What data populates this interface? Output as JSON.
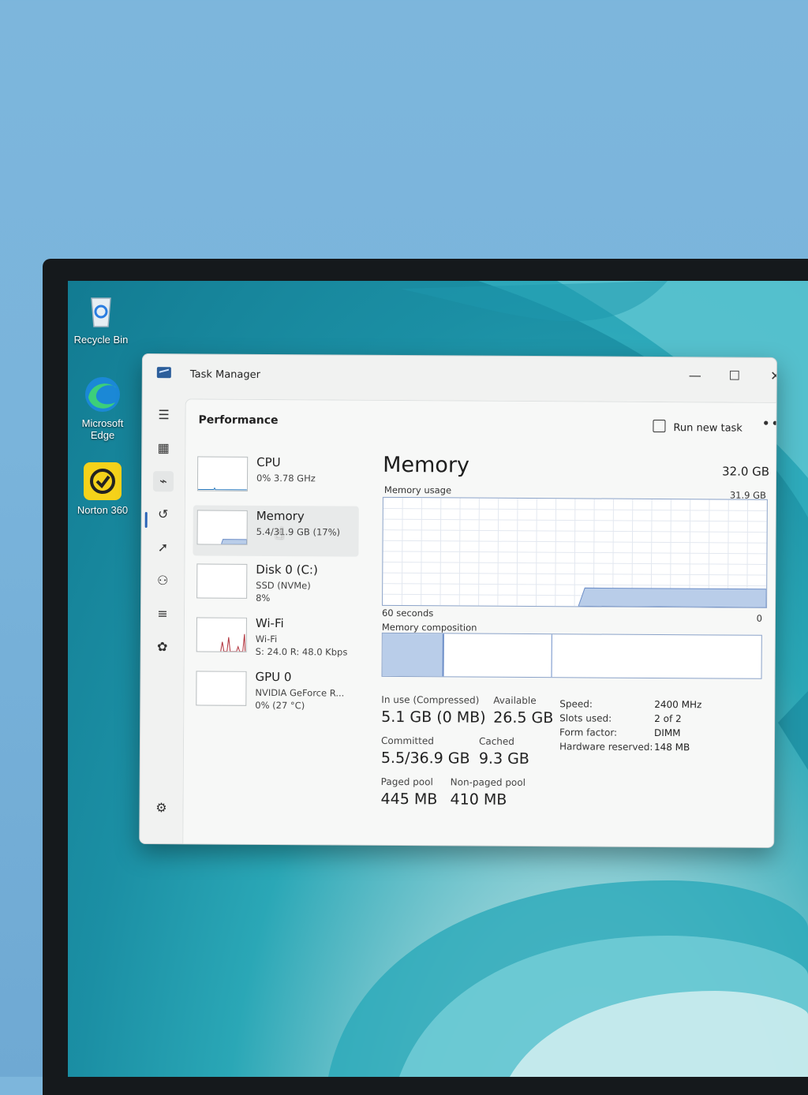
{
  "desktop": {
    "icons": [
      {
        "label": "Recycle Bin",
        "icon": "recycle-bin-icon"
      },
      {
        "label": "Microsoft Edge",
        "icon": "edge-icon"
      },
      {
        "label": "Norton 360",
        "icon": "norton-icon"
      }
    ]
  },
  "window": {
    "title": "Task Manager",
    "controls": {
      "minimize": "—",
      "maximize": "☐",
      "close": "✕"
    }
  },
  "toolbar": {
    "page_title": "Performance",
    "run_new_task": "Run new task",
    "more": "•••"
  },
  "devices": [
    {
      "name": "CPU",
      "line1": "0%  3.78 GHz",
      "line2": ""
    },
    {
      "name": "Memory",
      "line1": "5.4/31.9 GB (17%)",
      "line2": "",
      "selected": true
    },
    {
      "name": "Disk 0 (C:)",
      "line1": "SSD (NVMe)",
      "line2": "8%"
    },
    {
      "name": "Wi-Fi",
      "line1": "Wi-Fi",
      "line2": "S: 24.0  R: 48.0 Kbps"
    },
    {
      "name": "GPU 0",
      "line1": "NVIDIA GeForce R...",
      "line2": "0%  (27 °C)"
    }
  ],
  "memory": {
    "title": "Memory",
    "total": "32.0 GB",
    "usage_label": "Memory usage",
    "usage_max": "31.9 GB",
    "time_label": "60 seconds",
    "zero_label": "0",
    "composition_label": "Memory composition",
    "usage_fraction": 0.17,
    "stats": {
      "in_use_label": "In use (Compressed)",
      "in_use_value": "5.1 GB (0 MB)",
      "available_label": "Available",
      "available_value": "26.5 GB",
      "committed_label": "Committed",
      "committed_value": "5.5/36.9 GB",
      "cached_label": "Cached",
      "cached_value": "9.3 GB",
      "paged_label": "Paged pool",
      "paged_value": "445 MB",
      "nonpaged_label": "Non-paged pool",
      "nonpaged_value": "410 MB"
    },
    "specs": [
      {
        "label": "Speed:",
        "value": "2400 MHz"
      },
      {
        "label": "Slots used:",
        "value": "2 of 2"
      },
      {
        "label": "Form factor:",
        "value": "DIMM"
      },
      {
        "label": "Hardware reserved:",
        "value": "148 MB"
      }
    ]
  },
  "colors": {
    "accent": "#2b64b7",
    "graph_fill": "#b9cde9",
    "graph_line": "#6e8fc8"
  }
}
